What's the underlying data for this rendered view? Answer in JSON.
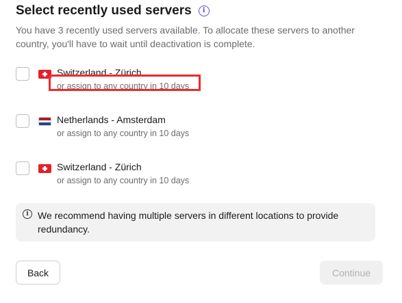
{
  "header": {
    "title": "Select recently used servers",
    "info_icon": "info-icon"
  },
  "description": "You have 3 recently used servers available. To allocate these servers to another country, you'll have to wait until deactivation is complete.",
  "servers": [
    {
      "name": "Switzerland - Zürich",
      "subtitle": "or assign to any country in 10 days",
      "flag": "switzerland-flag",
      "highlighted": true
    },
    {
      "name": "Netherlands - Amsterdam",
      "subtitle": "or assign to any country in 10 days",
      "flag": "netherlands-flag",
      "highlighted": false
    },
    {
      "name": "Switzerland - Zürich",
      "subtitle": "or assign to any country in 10 days",
      "flag": "switzerland-flag",
      "highlighted": false
    }
  ],
  "notice": {
    "icon": "info-icon",
    "text": "We recommend having multiple servers in different locations to provide redundancy."
  },
  "buttons": {
    "back_label": "Back",
    "continue_label": "Continue"
  },
  "colors": {
    "accent": "#5a4fe8",
    "highlight": "#ef2a2a",
    "disabled_bg": "#f0f0f0",
    "disabled_text": "#b0b0b0"
  }
}
